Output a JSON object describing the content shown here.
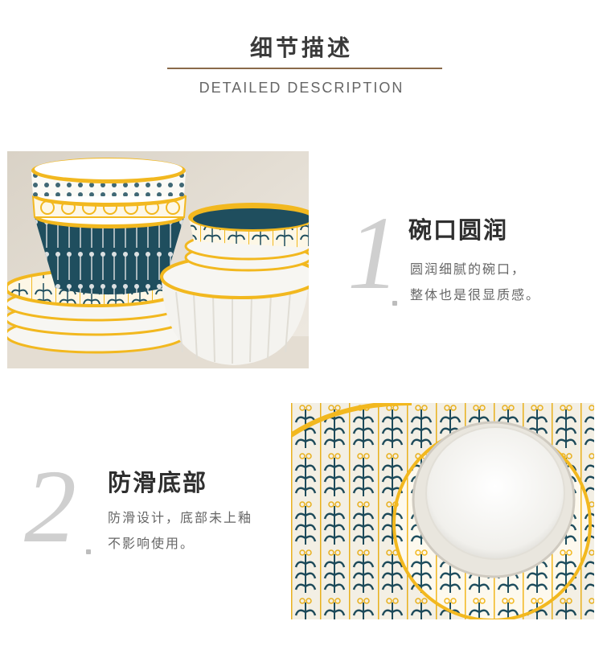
{
  "header": {
    "title": "细节描述",
    "subtitle": "DETAILED DESCRIPTION"
  },
  "features": [
    {
      "number": "1",
      "title": "碗口圆润",
      "desc_line1": "圆润细腻的碗口，",
      "desc_line2": "整体也是很显质感。"
    },
    {
      "number": "2",
      "title": "防滑底部",
      "desc_line1": "防滑设计，底部未上釉",
      "desc_line2": "不影响使用。"
    }
  ],
  "colors": {
    "accent_yellow": "#f2b81f",
    "ceramic_teal": "#1f4e5e",
    "ceramic_white": "#f7f6f2",
    "rule_brown": "#8a6a4a"
  }
}
